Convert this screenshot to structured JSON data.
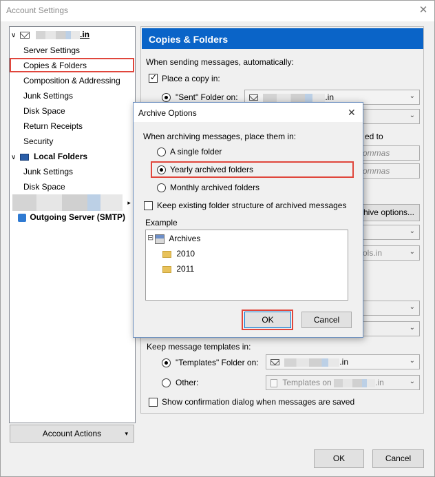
{
  "window": {
    "title": "Account Settings",
    "close_glyph": "✕"
  },
  "tree": {
    "account_suffix": ".in",
    "items": [
      {
        "label": "Server Settings"
      },
      {
        "label": "Copies & Folders"
      },
      {
        "label": "Composition & Addressing"
      },
      {
        "label": "Junk Settings"
      },
      {
        "label": "Disk Space"
      },
      {
        "label": "Return Receipts"
      },
      {
        "label": "Security"
      }
    ],
    "local_folders": "Local Folders",
    "local_items": [
      {
        "label": "Junk Settings"
      },
      {
        "label": "Disk Space"
      }
    ],
    "outgoing": "Outgoing Server (SMTP)",
    "twisty": "∨",
    "twisty_right": "▸"
  },
  "account_actions": {
    "label": "Account Actions",
    "chevron": "▾"
  },
  "pane": {
    "header": "Copies & Folders",
    "sending_label": "When sending messages, automatically:",
    "place_copy": "Place a copy in:",
    "sent_folder": "\"Sent\" Folder on:",
    "sent_combo_suffix": ".in",
    "partial_ed_to": "ed to",
    "partial_commas_1": "ommas",
    "partial_commas_2": "ommas",
    "partial_archive_btn": "hive options...",
    "partial_ols_in": "ols.in",
    "templates_label": "Keep message templates in:",
    "templates_folder": "\"Templates\" Folder on:",
    "templates_combo_suffix": ".in",
    "other": "Other:",
    "other_combo_prefix": "Templates on",
    "other_combo_suffix": ".in",
    "show_confirm": "Show confirmation dialog when messages are saved",
    "chevron": "⌄"
  },
  "footer": {
    "ok": "OK",
    "cancel": "Cancel"
  },
  "dialog": {
    "title": "Archive Options",
    "close_glyph": "✕",
    "place_label": "When archiving messages, place them in:",
    "options": [
      {
        "label": "A single folder",
        "selected": false
      },
      {
        "label": "Yearly archived folders",
        "selected": true
      },
      {
        "label": "Monthly archived folders",
        "selected": false
      }
    ],
    "keep_structure": "Keep existing folder structure of archived messages",
    "example_label": "Example",
    "tree_root": "Archives",
    "tree_children": [
      "2010",
      "2011"
    ],
    "tree_expander": "⊟",
    "ok": "OK",
    "cancel": "Cancel"
  },
  "colors": {
    "accent": "#0a64c8",
    "highlight": "#e0463c"
  }
}
